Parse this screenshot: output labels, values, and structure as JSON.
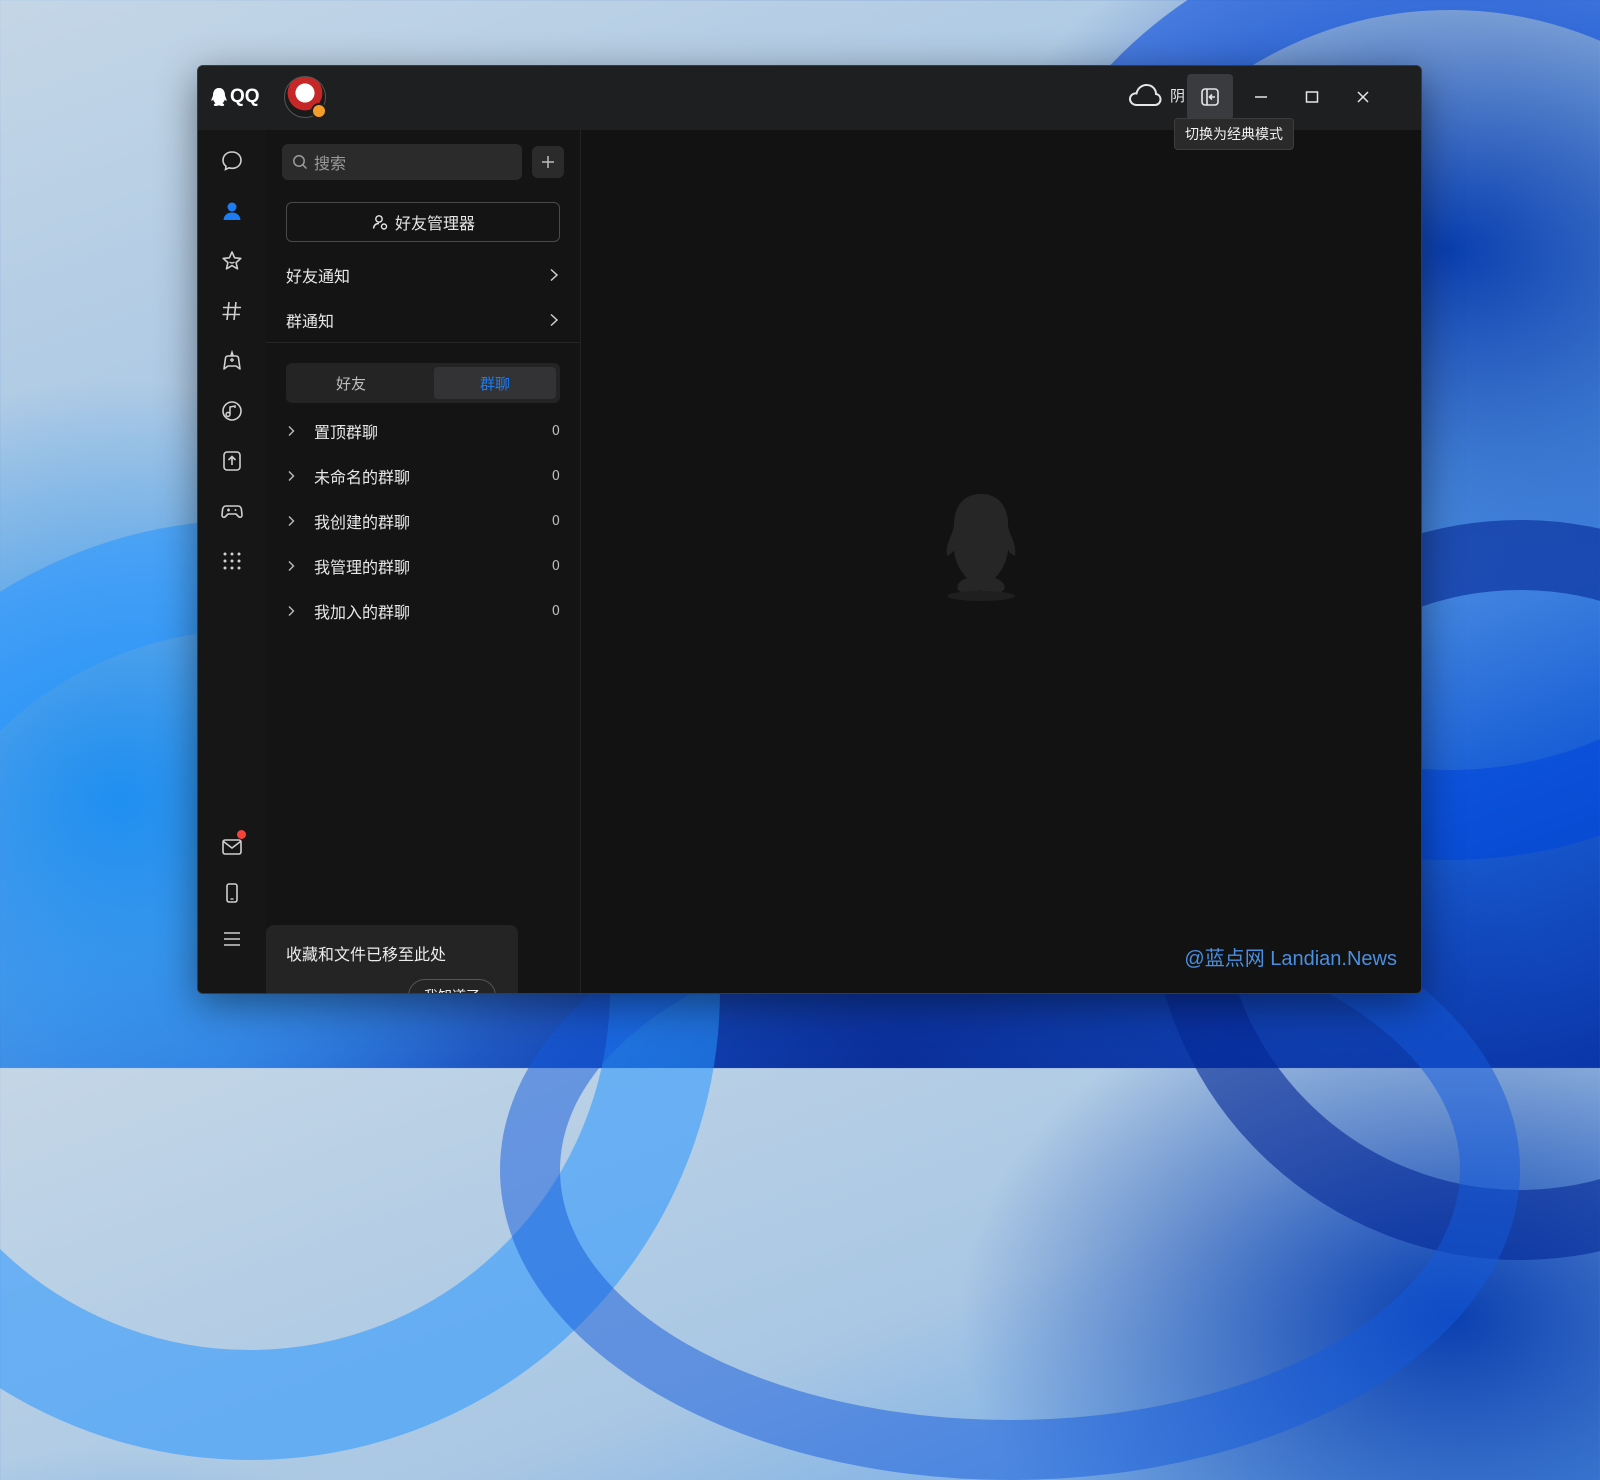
{
  "app": {
    "name": "QQ"
  },
  "titlebar": {
    "weather_text": "阴",
    "tooltip": "切换为经典模式"
  },
  "list": {
    "search_placeholder": "搜索",
    "manager_button": "好友管理器",
    "notices": [
      {
        "label": "好友通知"
      },
      {
        "label": "群通知"
      }
    ],
    "segments": {
      "friends": "好友",
      "groups": "群聊",
      "active": "群聊"
    },
    "groups": [
      {
        "name": "置顶群聊",
        "count": "0"
      },
      {
        "name": "未命名的群聊",
        "count": "0"
      },
      {
        "name": "我创建的群聊",
        "count": "0"
      },
      {
        "name": "我管理的群聊",
        "count": "0"
      },
      {
        "name": "我加入的群聊",
        "count": "0"
      }
    ]
  },
  "popup": {
    "text": "收藏和文件已移至此处",
    "button": "我知道了"
  },
  "watermark": "@蓝点网 Landian.News",
  "colors": {
    "accent": "#1d7cf2",
    "badge_red": "#f5433a",
    "background": "#121212"
  },
  "icons": {
    "rail": [
      "message-icon",
      "contacts-icon",
      "star-icon",
      "channel-icon",
      "game-center-icon",
      "music-icon",
      "upload-icon",
      "gamepad-icon",
      "apps-grid-icon",
      "mail-icon",
      "phone-icon",
      "menu-icon"
    ]
  }
}
